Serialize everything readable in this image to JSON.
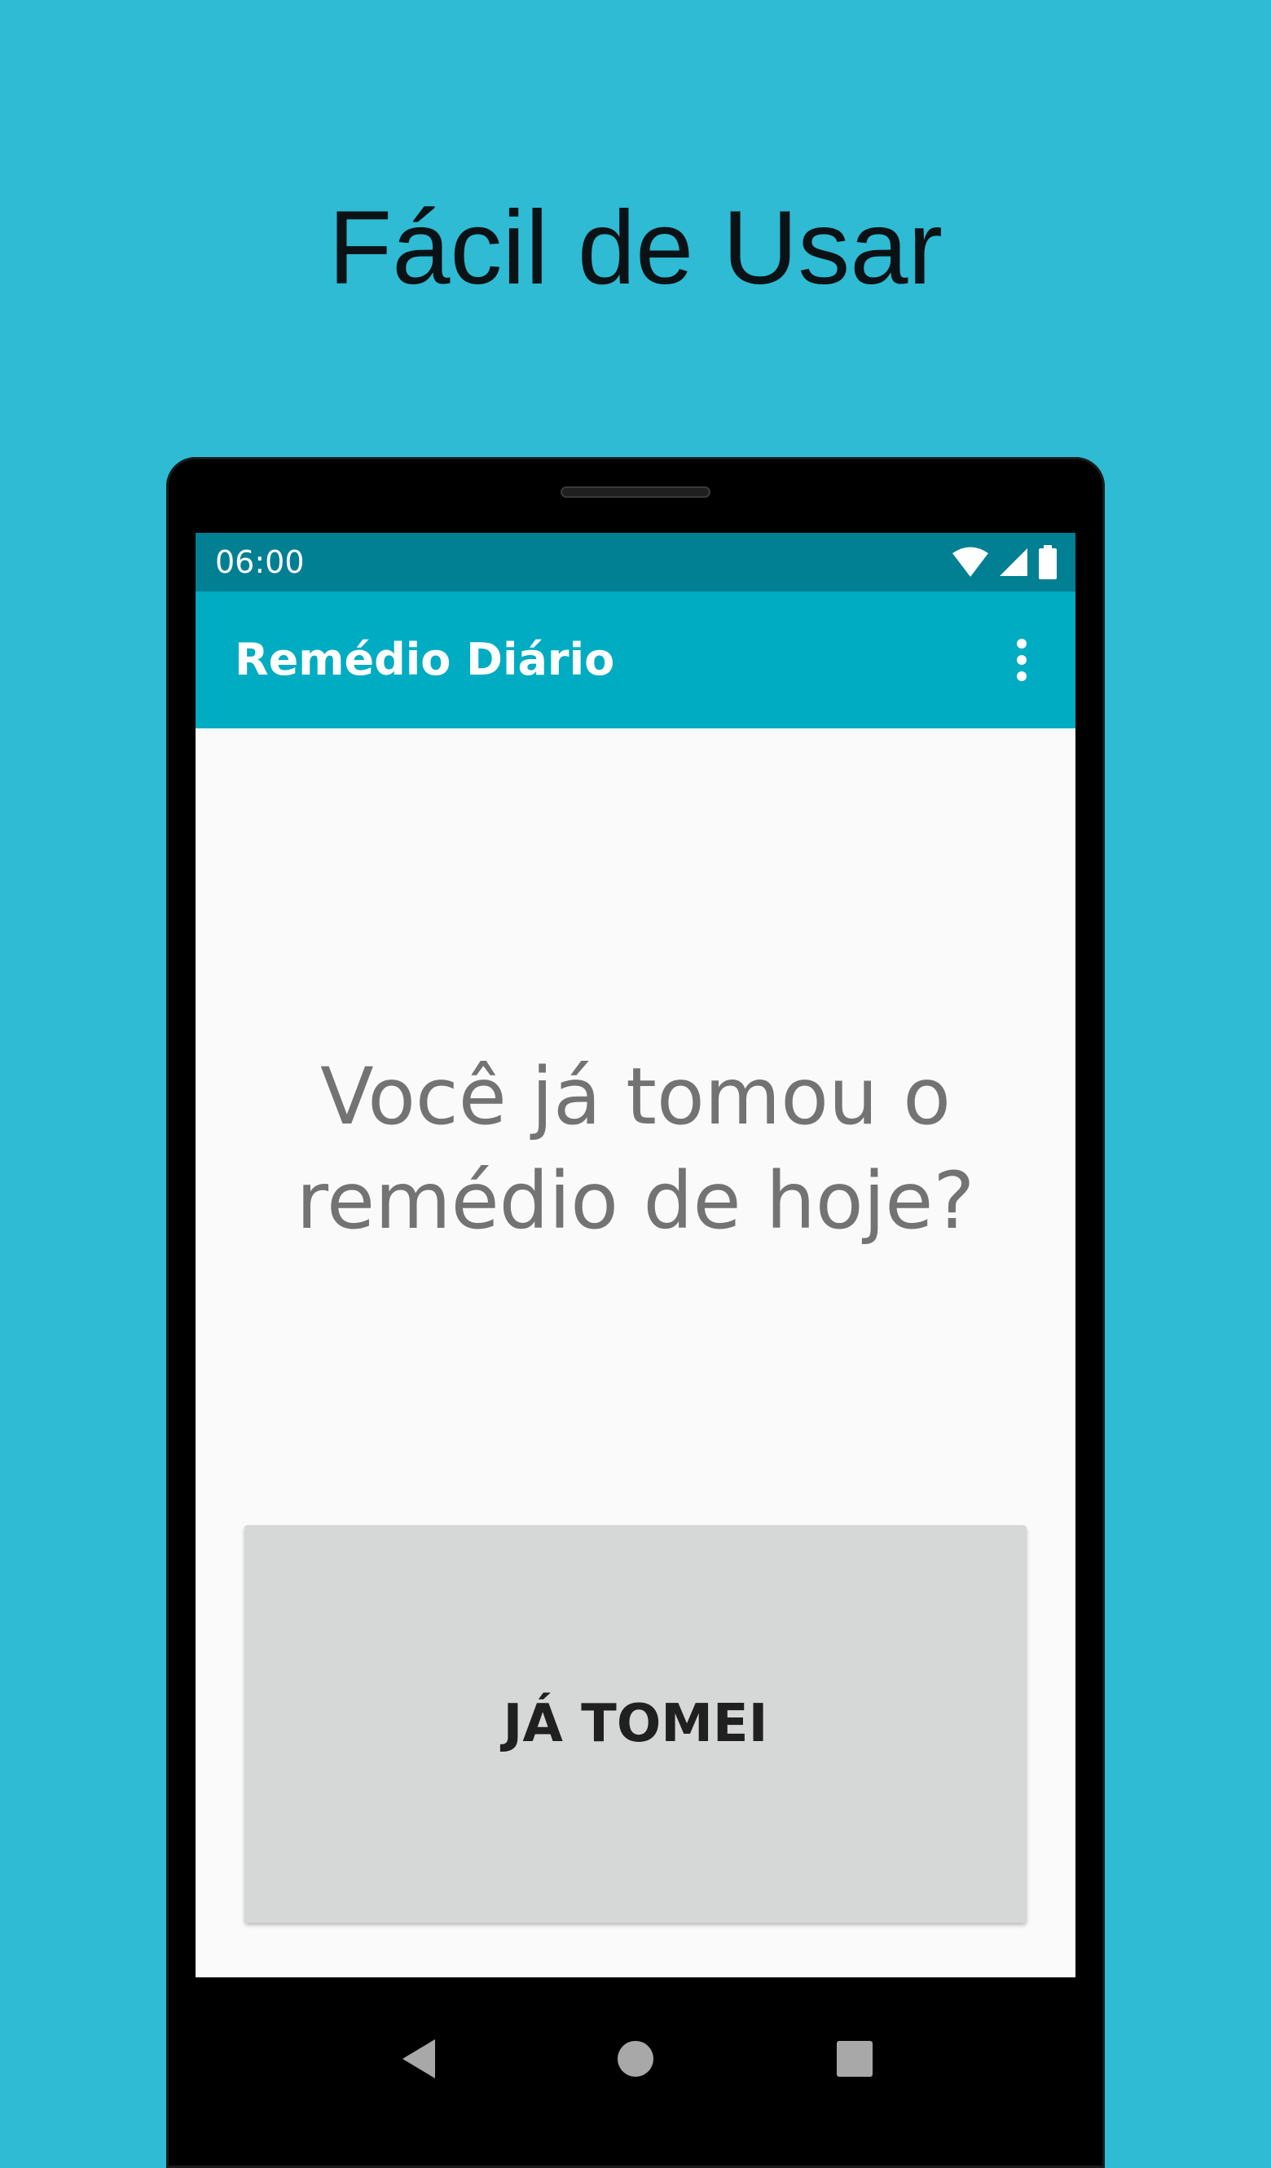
{
  "promo": {
    "headline": "Fácil de Usar"
  },
  "status_bar": {
    "time": "06:00",
    "icons": [
      "wifi-icon",
      "signal-icon",
      "battery-icon"
    ]
  },
  "app_bar": {
    "title": "Remédio Diário",
    "menu_icon": "more-vert-icon"
  },
  "main": {
    "question_line1": "Você já tomou o",
    "question_line2": "remédio de hoje?",
    "button_label": "JÁ TOMEI"
  },
  "nav_bar": {
    "icons": [
      "back-icon",
      "home-icon",
      "recents-icon"
    ]
  },
  "colors": {
    "background": "#2EBBD3",
    "status_bar": "#017F93",
    "app_bar": "#00ACC1",
    "screen": "#FAFAFA",
    "button": "#D6D7D7",
    "question_text": "#737373"
  }
}
